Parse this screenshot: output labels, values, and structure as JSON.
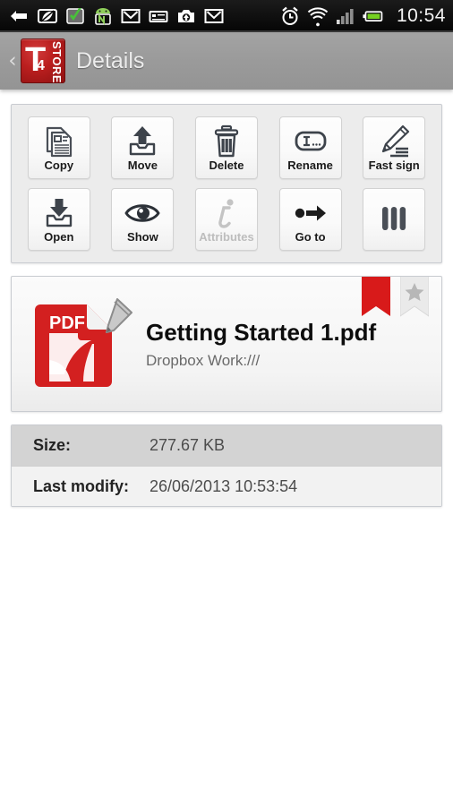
{
  "statusbar": {
    "clock": "10:54",
    "left_icons": [
      {
        "name": "back-arrow-badge-icon"
      },
      {
        "name": "evernote-leaf-icon"
      },
      {
        "name": "green-check-note-icon"
      },
      {
        "name": "android-n-icon"
      },
      {
        "name": "gmail-icon"
      },
      {
        "name": "sms-message-icon"
      },
      {
        "name": "camera-upload-icon"
      },
      {
        "name": "gmail-second-icon"
      }
    ],
    "right_icons": [
      {
        "name": "alarm-clock-icon"
      },
      {
        "name": "wifi-icon"
      },
      {
        "name": "cell-signal-icon"
      },
      {
        "name": "battery-icon"
      }
    ]
  },
  "actionbar": {
    "back_label": "‹",
    "logo": {
      "main": "T",
      "sub": "4",
      "vertical": "STORE"
    },
    "title": "Details"
  },
  "toolbar": {
    "buttons": [
      {
        "label": "Copy",
        "icon": "copy-icon",
        "enabled": true
      },
      {
        "label": "Move",
        "icon": "move-icon",
        "enabled": true
      },
      {
        "label": "Delete",
        "icon": "trash-icon",
        "enabled": true
      },
      {
        "label": "Rename",
        "icon": "rename-icon",
        "enabled": true
      },
      {
        "label": "Fast sign",
        "icon": "pencil-sign-icon",
        "enabled": true
      },
      {
        "label": "Open",
        "icon": "open-icon",
        "enabled": true
      },
      {
        "label": "Show",
        "icon": "eye-icon",
        "enabled": true
      },
      {
        "label": "Attributes",
        "icon": "info-italic-icon",
        "enabled": false
      },
      {
        "label": "Go to",
        "icon": "goto-arrow-icon",
        "enabled": true
      },
      {
        "label": "",
        "icon": "more-bars-icon",
        "enabled": true
      }
    ]
  },
  "filecard": {
    "icon": "pdf-file-icon",
    "name": "Getting Started 1.pdf",
    "path": "Dropbox Work:///",
    "bookmark": {
      "name": "red-bookmark-ribbon",
      "color": "#d81a1a",
      "active": true
    },
    "favorite": {
      "name": "star-ribbon",
      "color": "#b7b7b7",
      "active": false
    }
  },
  "details": {
    "rows": [
      {
        "key": "Size:",
        "value": "277.67 KB"
      },
      {
        "key": "Last modify:",
        "value": "26/06/2013 10:53:54"
      }
    ]
  },
  "colors": {
    "accent_red": "#bb1f1f",
    "actionbar": "#9a9a9a",
    "panel": "#ececec",
    "row_alt": "#d3d3d3"
  }
}
